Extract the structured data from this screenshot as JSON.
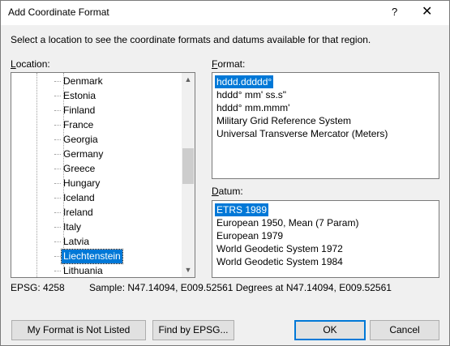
{
  "dialog": {
    "title": "Add Coordinate Format",
    "help": "?",
    "close": "✕"
  },
  "instruction": "Select a location to see the coordinate formats and datums available for that region.",
  "location": {
    "label_accel": "L",
    "label_rest": "ocation:",
    "items": [
      "Denmark",
      "Estonia",
      "Finland",
      "France",
      "Georgia",
      "Germany",
      "Greece",
      "Hungary",
      "Iceland",
      "Ireland",
      "Italy",
      "Latvia",
      "Liechtenstein",
      "Lithuania"
    ],
    "selected_index": 12,
    "scroll_up": "▲",
    "scroll_down": "▼"
  },
  "format": {
    "label_accel": "F",
    "label_rest": "ormat:",
    "items": [
      "hddd.ddddd°",
      "hddd° mm' ss.s\"",
      "hddd° mm.mmm'",
      "Military Grid Reference System",
      "Universal Transverse Mercator (Meters)"
    ],
    "selected_index": 0
  },
  "datum": {
    "label_accel": "D",
    "label_rest": "atum:",
    "items": [
      "ETRS 1989",
      "European 1950, Mean (7 Param)",
      "European 1979",
      "World Geodetic System 1972",
      "World Geodetic System 1984"
    ],
    "selected_index": 0
  },
  "status": {
    "epsg": "EPSG: 4258",
    "sample": "Sample: N47.14094, E009.52561 Degrees at N47.14094, E009.52561"
  },
  "buttons": {
    "not_listed": "My Format is Not Listed",
    "find_epsg": "Find by EPSG...",
    "ok": "OK",
    "cancel": "Cancel"
  },
  "colors": {
    "selection": "#0078d7",
    "dialog_bg": "#f0f0f0"
  }
}
